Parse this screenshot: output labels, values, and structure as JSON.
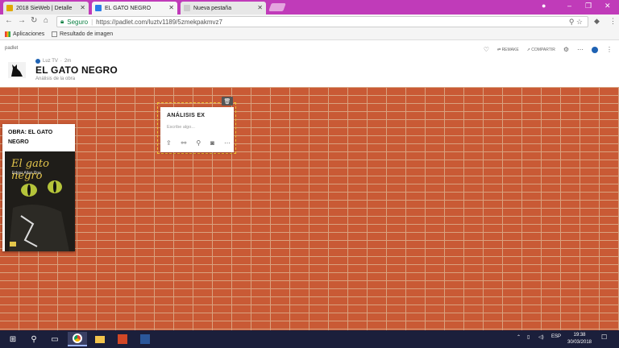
{
  "browser": {
    "tabs": [
      {
        "label": "2018 SieWeb | Detalle",
        "active": false
      },
      {
        "label": "EL GATO NEGRO",
        "active": true
      },
      {
        "label": "Nueva pestaña",
        "active": false
      }
    ],
    "address": {
      "secure_label": "Seguro",
      "url": "https://padlet.com/luztv1189/5zmekpakmvz7"
    },
    "bookmarks": [
      {
        "label": "Aplicaciones"
      },
      {
        "label": "Resultado de imagen"
      }
    ]
  },
  "padlet": {
    "brand": "padlet",
    "actions": {
      "remake": "REMAKE",
      "share": "COMPARTIR"
    },
    "author": "Luz TV",
    "time": "2m",
    "title": "EL GATO NEGRO",
    "description": "Análisis de la obra"
  },
  "post": {
    "title": "OBRA: EL GATO NEGRO",
    "cover_title": "El gato negro",
    "cover_author": "Edgar Allan Poe"
  },
  "composer": {
    "title_value": "ANÁLISIS EX",
    "body_placeholder": "Escribe algo..."
  },
  "taskbar": {
    "language": "ESP",
    "time": "19:38",
    "date": "30/03/2018"
  },
  "colors": {
    "tabstrip": "#c03bb9",
    "brick": "#c95a35",
    "mortar": "#d9a27f",
    "taskbar": "#1b1f3b",
    "composer_outline": "#f1c232"
  }
}
